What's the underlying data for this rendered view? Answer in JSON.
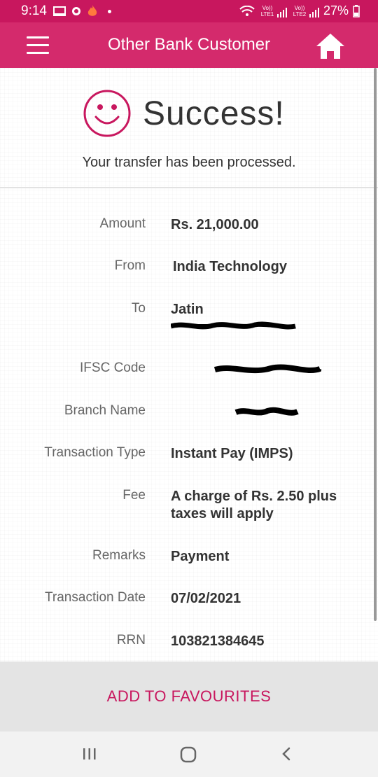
{
  "status_bar": {
    "time": "9:14",
    "carrier1": "Vo)) LTE1",
    "carrier2": "Vo)) LTE2",
    "battery": "27%"
  },
  "header": {
    "title": "Other Bank Customer",
    "brand_color": "#d42a6c"
  },
  "success": {
    "title": "Success!",
    "message": "Your transfer has been processed."
  },
  "details": [
    {
      "label": "Amount",
      "value": "Rs. 21,000.00"
    },
    {
      "label": "From",
      "value": "India Technology"
    },
    {
      "label": "To",
      "value": "Jatin"
    },
    {
      "label": "IFSC Code",
      "value": ""
    },
    {
      "label": "Branch Name",
      "value": ""
    },
    {
      "label": "Transaction Type",
      "value": "Instant Pay (IMPS)"
    },
    {
      "label": "Fee",
      "value": "A charge of Rs. 2.50 plus taxes will apply"
    },
    {
      "label": "Remarks",
      "value": "Payment"
    },
    {
      "label": "Transaction Date",
      "value": "07/02/2021"
    },
    {
      "label": "RRN",
      "value": "103821384645"
    }
  ],
  "actions": {
    "add_favourites": "ADD TO FAVOURITES"
  },
  "icons": {
    "menu": "hamburger-menu-icon",
    "home": "home-icon",
    "smiley": "smiley-icon",
    "nav_recents": "recents-icon",
    "nav_home": "home-circle-icon",
    "nav_back": "back-icon"
  }
}
